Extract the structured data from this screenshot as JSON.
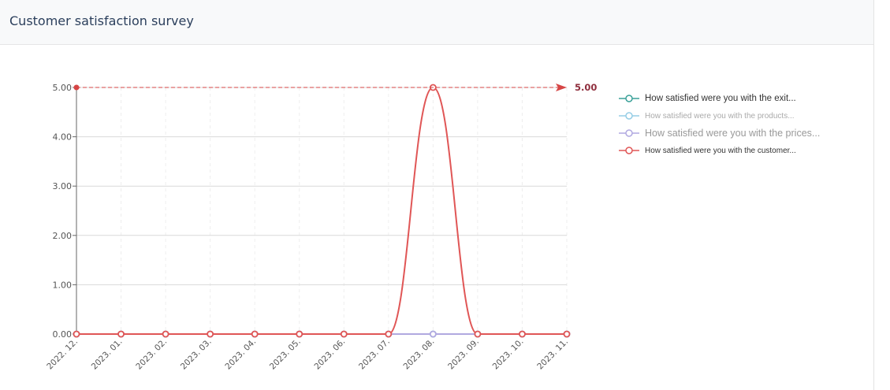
{
  "header": {
    "title": "Customer satisfaction survey"
  },
  "chart_data": {
    "type": "line",
    "categories": [
      "2022. 12.",
      "2023. 01.",
      "2023. 02.",
      "2023. 03.",
      "2023. 04.",
      "2023. 05.",
      "2023. 06.",
      "2023. 07.",
      "2023. 08.",
      "2023. 09.",
      "2023. 10.",
      "2023. 11."
    ],
    "ylim": [
      0,
      5
    ],
    "yticks": [
      "0.00",
      "1.00",
      "2.00",
      "3.00",
      "4.00",
      "5.00"
    ],
    "grid": true,
    "legend_position": "right",
    "smooth": true,
    "series": [
      {
        "name": "How satisfied were you with the exit...",
        "color": "#3aa199",
        "values": [
          0,
          0,
          0,
          0,
          0,
          0,
          0,
          0,
          0,
          0,
          0,
          0
        ]
      },
      {
        "name": "How satisfied were you with the products...",
        "color": "#95cde5",
        "values": [
          0,
          0,
          0,
          0,
          0,
          0,
          0,
          0,
          0,
          0,
          0,
          0
        ]
      },
      {
        "name": "How satisfied were you with the prices...",
        "color": "#b1a9e0",
        "values": [
          0,
          0,
          0,
          0,
          0,
          0,
          0,
          0,
          0,
          0,
          0,
          0
        ]
      },
      {
        "name": "How satisfied were you with the customer...",
        "color": "#e05656",
        "values": [
          0,
          0,
          0,
          0,
          0,
          0,
          0,
          0,
          5,
          0,
          0,
          0
        ]
      }
    ],
    "markline": {
      "value": 5.0,
      "label": "5.00",
      "color": "#d64545"
    }
  }
}
